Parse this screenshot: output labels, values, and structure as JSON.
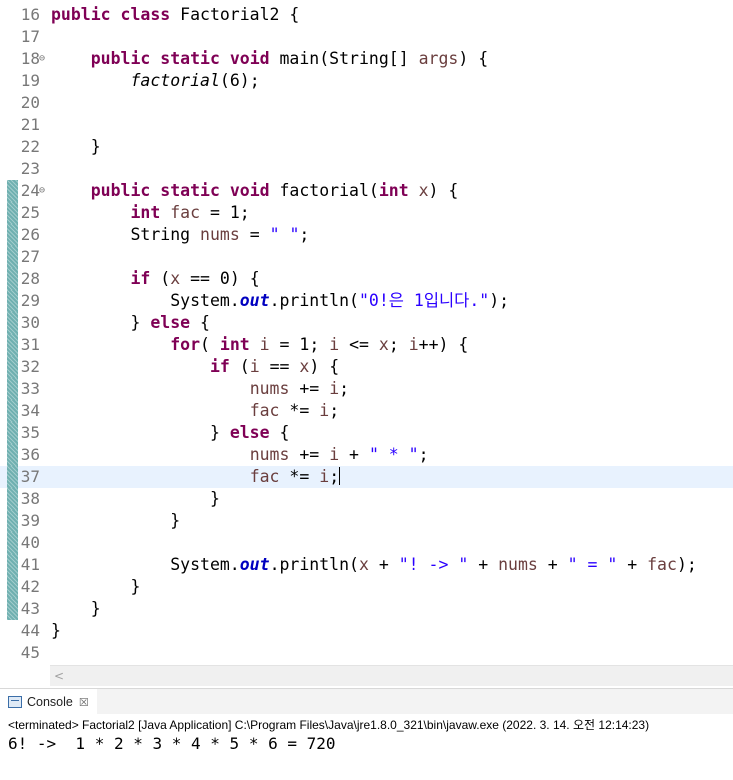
{
  "editor": {
    "lines": [
      {
        "n": "16",
        "marker": false,
        "fold": "",
        "current": false,
        "tokens": [
          [
            "kw",
            "public class "
          ],
          [
            "t",
            "Factorial2 {"
          ]
        ]
      },
      {
        "n": "17",
        "marker": false,
        "fold": "",
        "current": false,
        "tokens": []
      },
      {
        "n": "18",
        "marker": false,
        "fold": "⊖",
        "current": false,
        "tokens": [
          [
            "t",
            "    "
          ],
          [
            "kw",
            "public static void "
          ],
          [
            "t",
            "main(String[] "
          ],
          [
            "var",
            "args"
          ],
          [
            "t",
            ") {"
          ]
        ]
      },
      {
        "n": "19",
        "marker": false,
        "fold": "",
        "current": false,
        "tokens": [
          [
            "t",
            "        "
          ],
          [
            "ital",
            "factorial"
          ],
          [
            "t",
            "(6);"
          ]
        ]
      },
      {
        "n": "20",
        "marker": false,
        "fold": "",
        "current": false,
        "tokens": []
      },
      {
        "n": "21",
        "marker": false,
        "fold": "",
        "current": false,
        "tokens": []
      },
      {
        "n": "22",
        "marker": false,
        "fold": "",
        "current": false,
        "tokens": [
          [
            "t",
            "    }"
          ]
        ]
      },
      {
        "n": "23",
        "marker": false,
        "fold": "",
        "current": false,
        "tokens": []
      },
      {
        "n": "24",
        "marker": true,
        "fold": "⊖",
        "current": false,
        "tokens": [
          [
            "t",
            "    "
          ],
          [
            "kw",
            "public static void "
          ],
          [
            "t",
            "factorial("
          ],
          [
            "kw",
            "int "
          ],
          [
            "var",
            "x"
          ],
          [
            "t",
            ") {"
          ]
        ]
      },
      {
        "n": "25",
        "marker": true,
        "fold": "",
        "current": false,
        "tokens": [
          [
            "t",
            "        "
          ],
          [
            "kw",
            "int "
          ],
          [
            "var",
            "fac"
          ],
          [
            "t",
            " = 1;"
          ]
        ]
      },
      {
        "n": "26",
        "marker": true,
        "fold": "",
        "current": false,
        "tokens": [
          [
            "t",
            "        String "
          ],
          [
            "var",
            "nums"
          ],
          [
            "t",
            " = "
          ],
          [
            "str",
            "\" \""
          ],
          [
            "t",
            ";"
          ]
        ]
      },
      {
        "n": "27",
        "marker": true,
        "fold": "",
        "current": false,
        "tokens": []
      },
      {
        "n": "28",
        "marker": true,
        "fold": "",
        "current": false,
        "tokens": [
          [
            "t",
            "        "
          ],
          [
            "kw",
            "if "
          ],
          [
            "t",
            "("
          ],
          [
            "var",
            "x"
          ],
          [
            "t",
            " == 0) {"
          ]
        ]
      },
      {
        "n": "29",
        "marker": true,
        "fold": "",
        "current": false,
        "tokens": [
          [
            "t",
            "            System."
          ],
          [
            "stat",
            "out"
          ],
          [
            "t",
            ".println("
          ],
          [
            "str",
            "\"0!은 1입니다.\""
          ],
          [
            "t",
            ");"
          ]
        ]
      },
      {
        "n": "30",
        "marker": true,
        "fold": "",
        "current": false,
        "tokens": [
          [
            "t",
            "        } "
          ],
          [
            "kw",
            "else "
          ],
          [
            "t",
            "{"
          ]
        ]
      },
      {
        "n": "31",
        "marker": true,
        "fold": "",
        "current": false,
        "tokens": [
          [
            "t",
            "            "
          ],
          [
            "kw",
            "for"
          ],
          [
            "t",
            "( "
          ],
          [
            "kw",
            "int "
          ],
          [
            "var",
            "i"
          ],
          [
            "t",
            " = 1; "
          ],
          [
            "var",
            "i"
          ],
          [
            "t",
            " <= "
          ],
          [
            "var",
            "x"
          ],
          [
            "t",
            "; "
          ],
          [
            "var",
            "i"
          ],
          [
            "t",
            "++) {"
          ]
        ]
      },
      {
        "n": "32",
        "marker": true,
        "fold": "",
        "current": false,
        "tokens": [
          [
            "t",
            "                "
          ],
          [
            "kw",
            "if "
          ],
          [
            "t",
            "("
          ],
          [
            "var",
            "i"
          ],
          [
            "t",
            " == "
          ],
          [
            "var",
            "x"
          ],
          [
            "t",
            ") {"
          ]
        ]
      },
      {
        "n": "33",
        "marker": true,
        "fold": "",
        "current": false,
        "tokens": [
          [
            "t",
            "                    "
          ],
          [
            "var",
            "nums"
          ],
          [
            "t",
            " += "
          ],
          [
            "var",
            "i"
          ],
          [
            "t",
            ";"
          ]
        ]
      },
      {
        "n": "34",
        "marker": true,
        "fold": "",
        "current": false,
        "tokens": [
          [
            "t",
            "                    "
          ],
          [
            "var",
            "fac"
          ],
          [
            "t",
            " *= "
          ],
          [
            "var",
            "i"
          ],
          [
            "t",
            ";"
          ]
        ]
      },
      {
        "n": "35",
        "marker": true,
        "fold": "",
        "current": false,
        "tokens": [
          [
            "t",
            "                } "
          ],
          [
            "kw",
            "else "
          ],
          [
            "t",
            "{"
          ]
        ]
      },
      {
        "n": "36",
        "marker": true,
        "fold": "",
        "current": false,
        "tokens": [
          [
            "t",
            "                    "
          ],
          [
            "var",
            "nums"
          ],
          [
            "t",
            " += "
          ],
          [
            "var",
            "i"
          ],
          [
            "t",
            " + "
          ],
          [
            "str",
            "\" * \""
          ],
          [
            "t",
            ";"
          ]
        ]
      },
      {
        "n": "37",
        "marker": true,
        "fold": "",
        "current": true,
        "tokens": [
          [
            "t",
            "                    "
          ],
          [
            "var",
            "fac"
          ],
          [
            "t",
            " *= "
          ],
          [
            "var",
            "i"
          ],
          [
            "t",
            ";"
          ]
        ]
      },
      {
        "n": "38",
        "marker": true,
        "fold": "",
        "current": false,
        "tokens": [
          [
            "t",
            "                }"
          ]
        ]
      },
      {
        "n": "39",
        "marker": true,
        "fold": "",
        "current": false,
        "tokens": [
          [
            "t",
            "            }"
          ]
        ]
      },
      {
        "n": "40",
        "marker": true,
        "fold": "",
        "current": false,
        "tokens": []
      },
      {
        "n": "41",
        "marker": true,
        "fold": "",
        "current": false,
        "tokens": [
          [
            "t",
            "            System."
          ],
          [
            "stat",
            "out"
          ],
          [
            "t",
            ".println("
          ],
          [
            "var",
            "x"
          ],
          [
            "t",
            " + "
          ],
          [
            "str",
            "\"! -> \""
          ],
          [
            "t",
            " + "
          ],
          [
            "var",
            "nums"
          ],
          [
            "t",
            " + "
          ],
          [
            "str",
            "\" = \""
          ],
          [
            "t",
            " + "
          ],
          [
            "var",
            "fac"
          ],
          [
            "t",
            ");"
          ]
        ]
      },
      {
        "n": "42",
        "marker": true,
        "fold": "",
        "current": false,
        "tokens": [
          [
            "t",
            "        }"
          ]
        ]
      },
      {
        "n": "43",
        "marker": true,
        "fold": "",
        "current": false,
        "tokens": [
          [
            "t",
            "    }"
          ]
        ]
      },
      {
        "n": "44",
        "marker": false,
        "fold": "",
        "current": false,
        "tokens": [
          [
            "t",
            "}"
          ]
        ]
      },
      {
        "n": "45",
        "marker": false,
        "fold": "",
        "current": false,
        "tokens": []
      }
    ]
  },
  "scrollbar": {
    "left_arrow": "<"
  },
  "console": {
    "tab_label": "Console",
    "close_glyph": "☒",
    "terminated_text": "<terminated> Factorial2 [Java Application] C:\\Program Files\\Java\\jre1.8.0_321\\bin\\javaw.exe (2022. 3. 14. 오전 12:14:23)",
    "output_text": "6! ->  1 * 2 * 3 * 4 * 5 * 6 = 720"
  },
  "colors": {
    "keyword": "#7f0055",
    "string": "#2a00ff",
    "variable": "#6a3e3e",
    "static_field": "#0000c0",
    "current_line": "#e8f2fe",
    "change_marker": "#6fb0b0"
  }
}
